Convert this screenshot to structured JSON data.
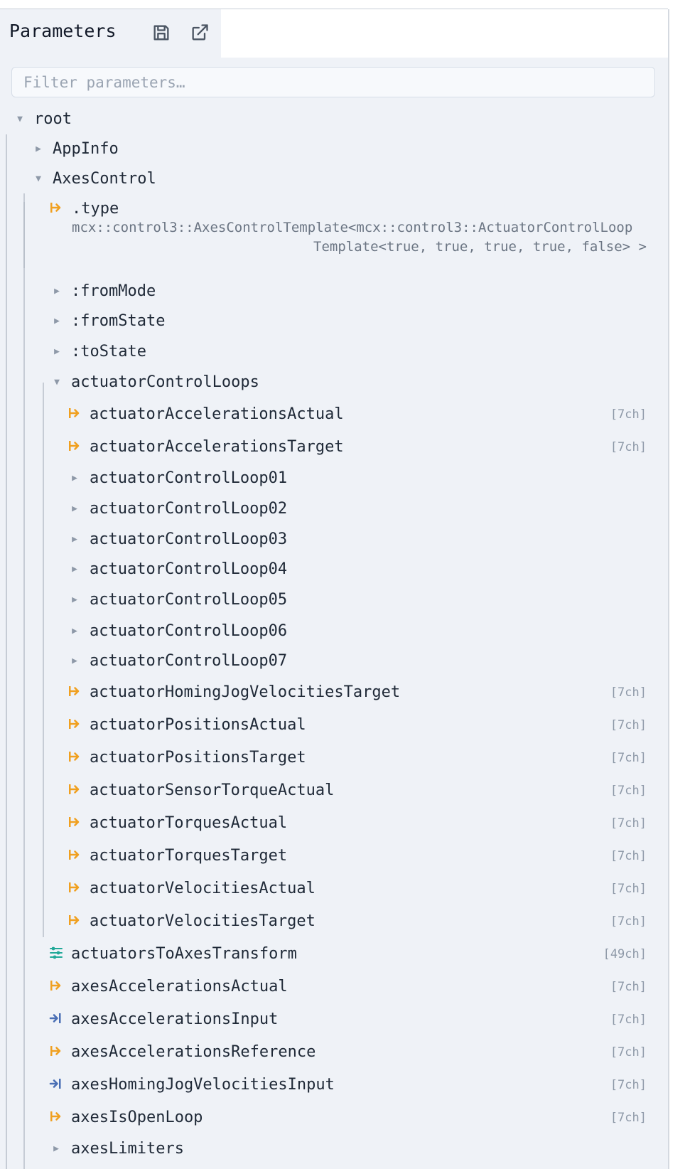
{
  "panel": {
    "title": "Parameters",
    "save_icon": "save-icon",
    "open_icon": "open-external-icon",
    "filter": {
      "placeholder": "Filter parameters…",
      "value": ""
    }
  },
  "tree": {
    "root_label": "root",
    "appinfo_label": "AppInfo",
    "axescontrol_label": "AxesControl",
    "type_label": ".type",
    "type_value_line1": "mcx::control3::AxesControlTemplate<mcx::control3::ActuatorControlLoop",
    "type_value_line2": "Template<true, true, true, true, false> >",
    "frommode_label": ":fromMode",
    "fromstate_label": ":fromState",
    "tostate_label": ":toState",
    "acl_label": "actuatorControlLoops",
    "acl_items": [
      {
        "label": "actuatorAccelerationsActual",
        "meta": "[7ch]",
        "icon": "output"
      },
      {
        "label": "actuatorAccelerationsTarget",
        "meta": "[7ch]",
        "icon": "output"
      },
      {
        "label": "actuatorControlLoop01"
      },
      {
        "label": "actuatorControlLoop02"
      },
      {
        "label": "actuatorControlLoop03"
      },
      {
        "label": "actuatorControlLoop04"
      },
      {
        "label": "actuatorControlLoop05"
      },
      {
        "label": "actuatorControlLoop06"
      },
      {
        "label": "actuatorControlLoop07"
      },
      {
        "label": "actuatorHomingJogVelocitiesTarget",
        "meta": "[7ch]",
        "icon": "output"
      },
      {
        "label": "actuatorPositionsActual",
        "meta": "[7ch]",
        "icon": "output"
      },
      {
        "label": "actuatorPositionsTarget",
        "meta": "[7ch]",
        "icon": "output"
      },
      {
        "label": "actuatorSensorTorqueActual",
        "meta": "[7ch]",
        "icon": "output"
      },
      {
        "label": "actuatorTorquesActual",
        "meta": "[7ch]",
        "icon": "output"
      },
      {
        "label": "actuatorTorquesTarget",
        "meta": "[7ch]",
        "icon": "output"
      },
      {
        "label": "actuatorVelocitiesActual",
        "meta": "[7ch]",
        "icon": "output"
      },
      {
        "label": "actuatorVelocitiesTarget",
        "meta": "[7ch]",
        "icon": "output"
      }
    ],
    "ac_items": [
      {
        "label": "actuatorsToAxesTransform",
        "meta": "[49ch]",
        "icon": "parameter"
      },
      {
        "label": "axesAccelerationsActual",
        "meta": "[7ch]",
        "icon": "output"
      },
      {
        "label": "axesAccelerationsInput",
        "meta": "[7ch]",
        "icon": "input"
      },
      {
        "label": "axesAccelerationsReference",
        "meta": "[7ch]",
        "icon": "output"
      },
      {
        "label": "axesHomingJogVelocitiesInput",
        "meta": "[7ch]",
        "icon": "input"
      },
      {
        "label": "axesIsOpenLoop",
        "meta": "[7ch]",
        "icon": "output"
      },
      {
        "label": "axesLimiters"
      }
    ]
  },
  "colors": {
    "output_icon": "#f0a020",
    "input_icon": "#4a6fb5",
    "parameter_icon": "#20a898"
  }
}
